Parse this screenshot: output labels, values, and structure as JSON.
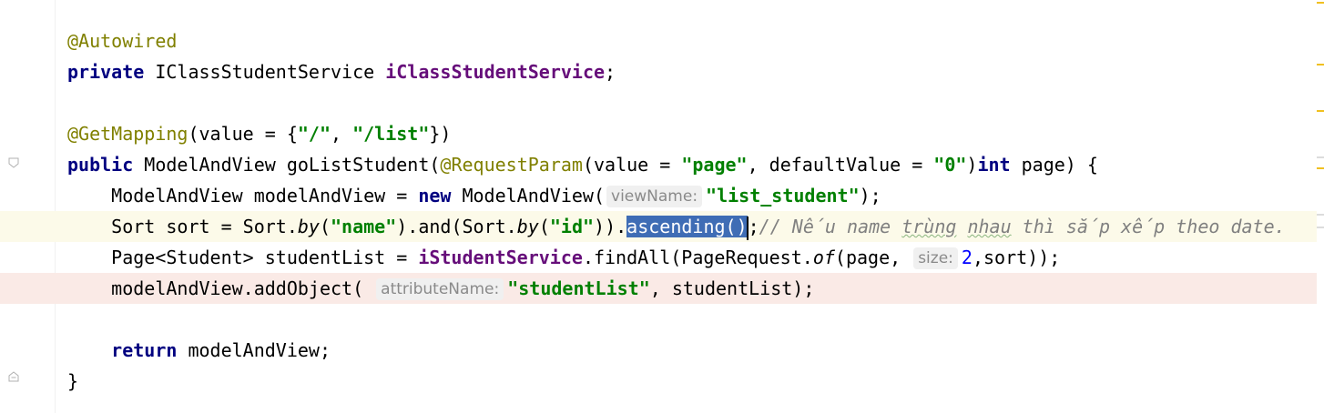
{
  "code": {
    "lines": [
      {
        "parts": [
          {
            "t": "@Autowired",
            "c": "ann"
          }
        ]
      },
      {
        "parts": [
          {
            "t": "private",
            "c": "kw"
          },
          {
            "t": " IClassStudentService "
          },
          {
            "t": "iClassStudentService",
            "c": "fld"
          },
          {
            "t": ";"
          }
        ]
      },
      {
        "parts": []
      },
      {
        "parts": [
          {
            "t": "@GetMapping",
            "c": "ann"
          },
          {
            "t": "(value = {"
          },
          {
            "t": "\"/\"",
            "c": "str"
          },
          {
            "t": ", "
          },
          {
            "t": "\"/list\"",
            "c": "str"
          },
          {
            "t": "})"
          }
        ]
      },
      {
        "parts": [
          {
            "t": "public",
            "c": "kw"
          },
          {
            "t": " ModelAndView goListStudent("
          },
          {
            "t": "@RequestParam",
            "c": "ann"
          },
          {
            "t": "(value = "
          },
          {
            "t": "\"page\"",
            "c": "str"
          },
          {
            "t": ", defaultValue = "
          },
          {
            "t": "\"0\"",
            "c": "str"
          },
          {
            "t": ")"
          },
          {
            "t": "int",
            "c": "kw"
          },
          {
            "t": " page) {"
          }
        ]
      },
      {
        "parts": [
          {
            "t": "    ModelAndView modelAndView = "
          },
          {
            "t": "new",
            "c": "kw"
          },
          {
            "t": " ModelAndView("
          },
          {
            "t": "viewName:",
            "c": "hint"
          },
          {
            "t": "\"list_student\"",
            "c": "str"
          },
          {
            "t": ");"
          }
        ]
      },
      {
        "row": "caret",
        "parts": [
          {
            "t": "    Sort sort = Sort."
          },
          {
            "t": "by",
            "c": "it"
          },
          {
            "t": "("
          },
          {
            "t": "\"name\"",
            "c": "str"
          },
          {
            "t": ").and(Sort."
          },
          {
            "t": "by",
            "c": "it"
          },
          {
            "t": "("
          },
          {
            "t": "\"id\"",
            "c": "str"
          },
          {
            "t": "))."
          },
          {
            "t": "ascending()",
            "c": "sel"
          },
          {
            "t": "",
            "c": "cursor"
          },
          {
            "t": ";"
          },
          {
            "t": "// Nếu name ",
            "c": "cmt"
          },
          {
            "t": "trùng",
            "c": "cmt wavy"
          },
          {
            "t": " ",
            "c": "cmt"
          },
          {
            "t": "nhau",
            "c": "cmt wavy"
          },
          {
            "t": " thì sắp xếp theo date.",
            "c": "cmt"
          }
        ]
      },
      {
        "parts": [
          {
            "t": "    Page<Student> studentList = "
          },
          {
            "t": "iStudentService",
            "c": "fld"
          },
          {
            "t": ".findAll(PageRequest."
          },
          {
            "t": "of",
            "c": "it"
          },
          {
            "t": "(page, "
          },
          {
            "t": "size:",
            "c": "hint"
          },
          {
            "t": "2",
            "c": "num"
          },
          {
            "t": ",sort));"
          }
        ]
      },
      {
        "row": "error",
        "parts": [
          {
            "t": "    modelAndView.addObject( "
          },
          {
            "t": "attributeName:",
            "c": "hint"
          },
          {
            "t": "\"studentList\"",
            "c": "str"
          },
          {
            "t": ", studentList);"
          }
        ]
      },
      {
        "parts": []
      },
      {
        "parts": [
          {
            "t": "    "
          },
          {
            "t": "return",
            "c": "kw"
          },
          {
            "t": " modelAndView;"
          }
        ]
      },
      {
        "parts": [
          {
            "t": "}"
          }
        ]
      }
    ]
  },
  "colors": {
    "keyword": "#000080",
    "annotation": "#808000",
    "string": "#008000",
    "field": "#660e7a",
    "comment": "#808080",
    "selection": "#3f6db5",
    "caret_row": "#fcfae9",
    "error_row": "#faeae6"
  },
  "icons": [
    "fold-start-icon",
    "fold-end-icon",
    "error-stripe-marks"
  ]
}
